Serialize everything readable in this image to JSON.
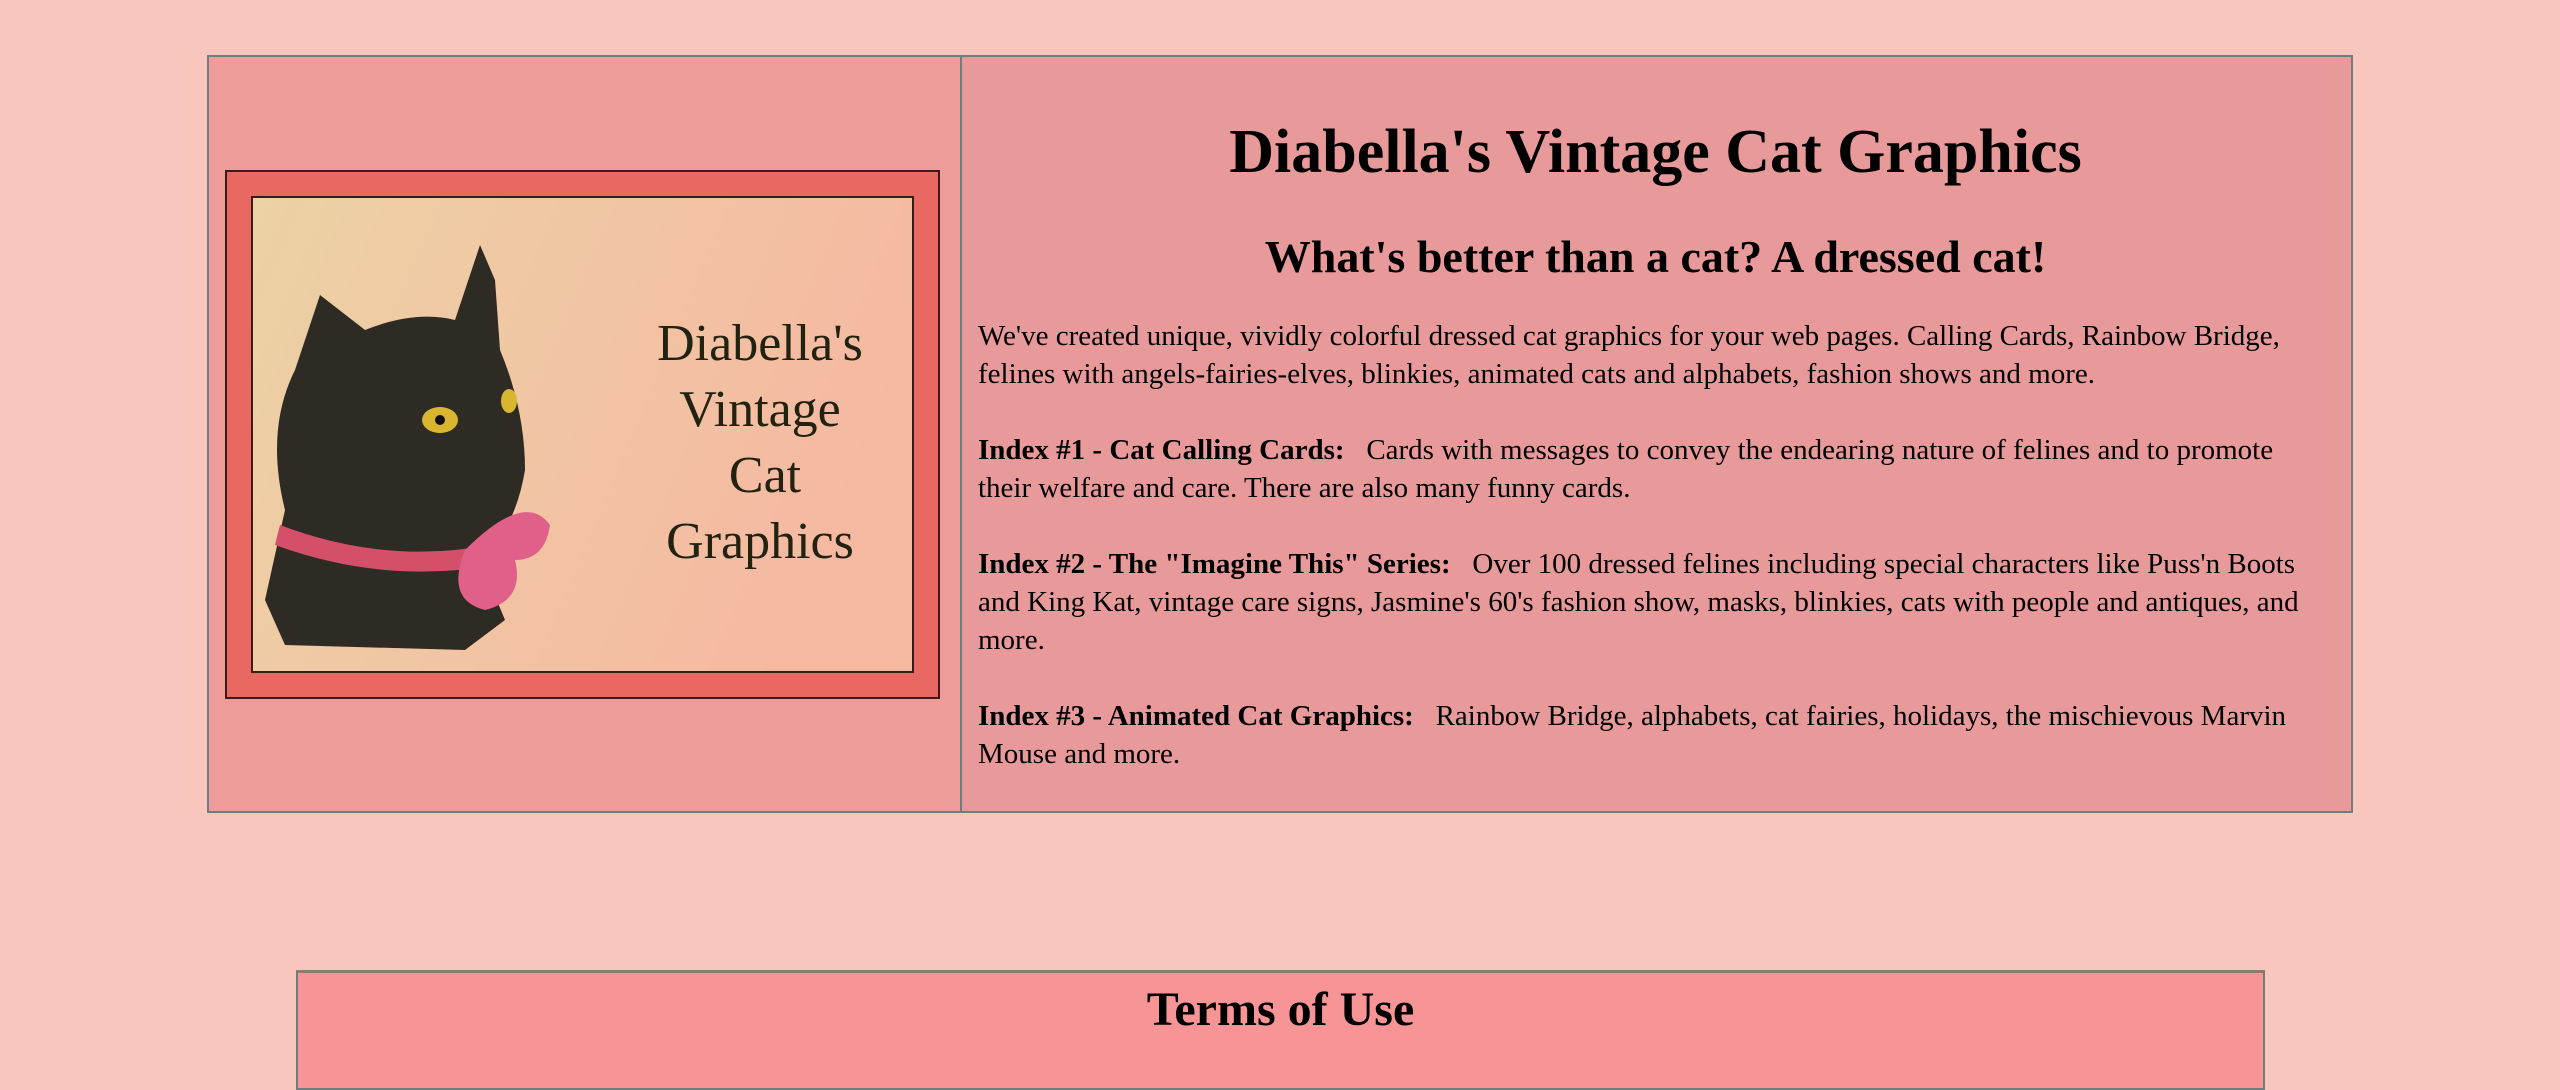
{
  "logo": {
    "text_lines": [
      "Diabella's",
      "Vintage",
      "Cat",
      "Graphics"
    ]
  },
  "header": {
    "title": "Diabella's Vintage Cat Graphics",
    "subtitle": "What's better than a cat? A dressed cat!"
  },
  "intro": "We've created unique, vividly colorful dressed cat graphics for your web pages. Calling Cards, Rainbow Bridge, felines with angels-fairies-elves, blinkies, animated cats and alphabets, fashion shows and more.",
  "indexes": [
    {
      "label": "Index #1 - Cat Calling Cards:",
      "text": "Cards with messages to convey the endearing nature of felines and to promote their welfare and care. There are also many funny cards."
    },
    {
      "label": "Index #2 - The \"Imagine This\" Series:",
      "text": "Over 100 dressed felines including special characters like Puss'n Boots and King Kat, vintage care signs, Jasmine's 60's fashion show, masks, blinkies, cats with people and antiques, and more."
    },
    {
      "label": "Index #3 - Animated Cat Graphics:",
      "text": "Rainbow Bridge, alphabets, cat fairies, holidays, the mischievous Marvin Mouse and more."
    }
  ],
  "terms": {
    "title": "Terms of Use"
  },
  "colors": {
    "background": "#f9c6bd",
    "left_cell": "#ee9c99",
    "right_cell": "#e8999a",
    "terms_box": "#f79596"
  }
}
